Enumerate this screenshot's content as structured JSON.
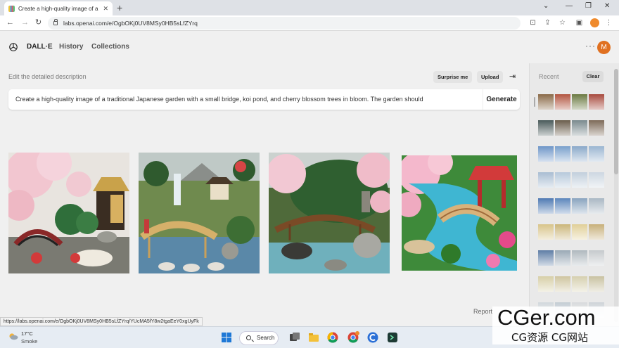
{
  "browser": {
    "tab_title": "Create a high-quality image of a",
    "new_tab_label": "+",
    "url": "labs.openai.com/e/OgbOKj0UV8MSy0HB5sLfZYrq",
    "status_url": "https://labs.openai.com/e/OgbOKj0UV8MSy0HB5sLfZYrq/YUcMA5fY8w2tgaEeY0xgUyFk"
  },
  "header": {
    "brand": "DALL·E",
    "nav": [
      "History",
      "Collections"
    ],
    "more_label": "···",
    "avatar_initial": "M"
  },
  "editor": {
    "label": "Edit the detailed description",
    "surprise_label": "Surprise me",
    "upload_label": "Upload",
    "prompt_text": "Create a high-quality image of a traditional Japanese garden with a small bridge, koi pond, and cherry blossom trees in bloom. The garden should",
    "generate_label": "Generate"
  },
  "results": {
    "report_label": "Report"
  },
  "sidebar": {
    "title": "Recent",
    "clear_label": "Clear",
    "colors": {
      "garden": [
        "#8a6a48",
        "#b25540",
        "#6b7a42",
        "#a84a3e"
      ],
      "dark": [
        "#4a5a5a",
        "#6a5d4c",
        "#7a8a8e",
        "#7d6a58"
      ],
      "blue": [
        "#6e96c8",
        "#79a0cc",
        "#8aa9c9",
        "#9bb6d1"
      ],
      "pale": [
        "#a9bdd2",
        "#b7c9db",
        "#c2cfdc",
        "#cdd7e1"
      ],
      "deep": [
        "#4f7ab3",
        "#5c86bc",
        "#89a4bf",
        "#aab8c4"
      ],
      "gold": [
        "#d8c48a",
        "#cbb67a",
        "#e0cf98",
        "#c7b07a"
      ],
      "grey": [
        "#5f7ea6",
        "#9aa9b6",
        "#b0b9bf",
        "#c6cacd"
      ],
      "sand": [
        "#d7cfa8",
        "#cfc5a0",
        "#d6d0b0",
        "#c9c2a2"
      ],
      "light": [
        "#d2d8dc",
        "#c4cdd4",
        "#d8dadc",
        "#cfd4d8"
      ]
    }
  },
  "taskbar": {
    "temperature": "17°C",
    "condition": "Smoke",
    "search_label": "Search"
  },
  "watermark": {
    "line1": "CGer.com",
    "line2": "CG资源 CG网站"
  }
}
